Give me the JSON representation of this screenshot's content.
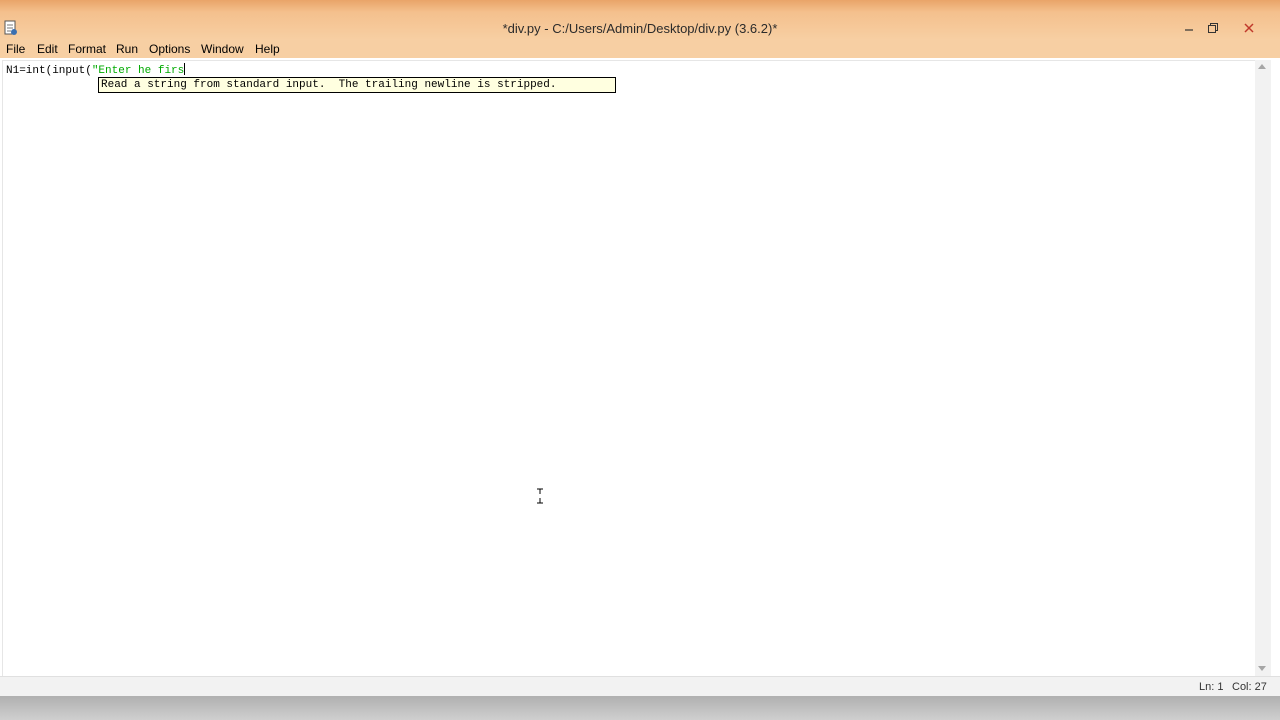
{
  "window": {
    "title": "*div.py - C:/Users/Admin/Desktop/div.py (3.6.2)*"
  },
  "menu": {
    "items": [
      "File",
      "Edit",
      "Format",
      "Run",
      "Options",
      "Window",
      "Help"
    ]
  },
  "editor": {
    "code_prefix": "N1=int(input(",
    "code_string": "\"Enter he firs",
    "calltip": "Read a string from standard input.  The trailing newline is stripped."
  },
  "status": {
    "line": "Ln: 1",
    "col": "Col: 27"
  },
  "icons": {
    "app": "python-idle-icon",
    "minimize": "minimize-icon",
    "maximize": "restore-icon",
    "close": "close-icon"
  },
  "colors": {
    "titlebar": "#f4c08d",
    "string_literal": "#00aa00",
    "calltip_bg": "#ffffe0"
  }
}
